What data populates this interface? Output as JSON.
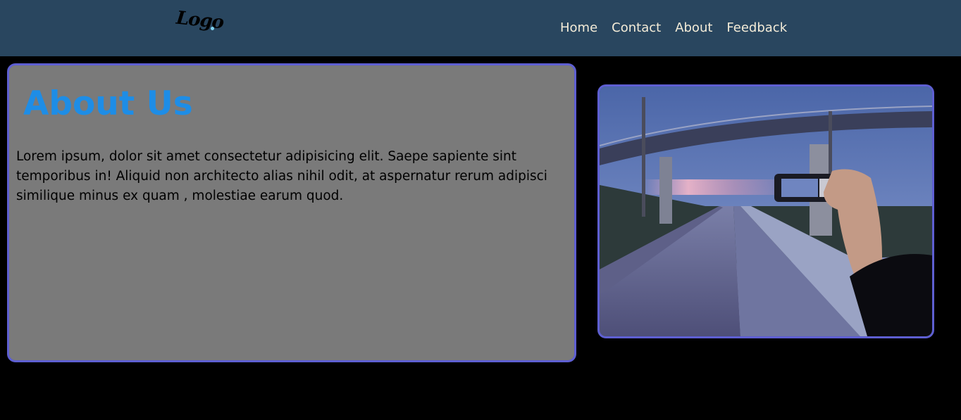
{
  "nav": {
    "logo_text": "Logo",
    "links": [
      {
        "label": "Home"
      },
      {
        "label": "Contact"
      },
      {
        "label": "About"
      },
      {
        "label": "Feedback"
      }
    ]
  },
  "about": {
    "title": "About Us",
    "body": "Lorem ipsum, dolor sit amet consectetur adipisicing elit. Saepe sapiente sint temporibus in! Aliquid non architecto alias nihil odit, at aspernatur rerum adipisci similique minus ex quam , molestiae earum quod."
  },
  "photo": {
    "subject": "hand-holding-phone-under-overpass-photo"
  },
  "colors": {
    "navbar_bg": "#29465f",
    "nav_text": "#f4ecd8",
    "page_bg": "#000000",
    "card_bg": "#7a7a7a",
    "card_border": "#5e5fd2",
    "title": "#1e8de6"
  }
}
